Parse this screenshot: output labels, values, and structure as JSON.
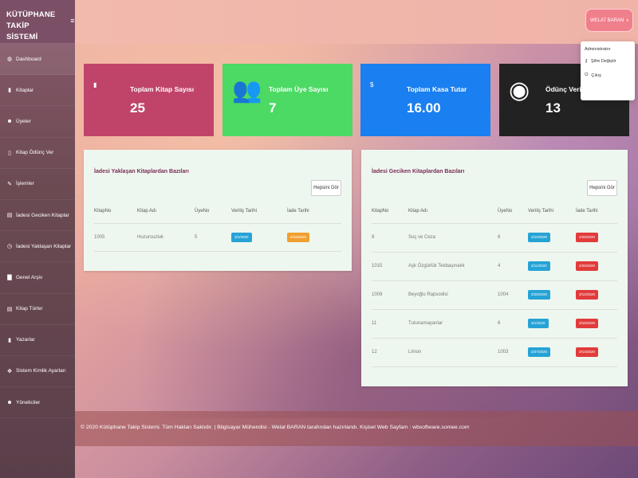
{
  "brand": {
    "title_line1": "KÜTÜPHANE TAKİP",
    "title_line2": "SİSTEMİ",
    "toggle_icon": "≡"
  },
  "sidebar": {
    "items": [
      {
        "label": "Dashboard",
        "icon": "dashboard-icon",
        "glyph": "◍"
      },
      {
        "label": "Kitaplar",
        "icon": "book-icon",
        "glyph": "▮"
      },
      {
        "label": "Üyeler",
        "icon": "users-icon",
        "glyph": "☻"
      },
      {
        "label": "Kitap Ödünç Ver",
        "icon": "lend-icon",
        "glyph": "▯"
      },
      {
        "label": "İşlemler",
        "icon": "pencil-icon",
        "glyph": "✎"
      },
      {
        "label": "İadesi Geciken Kitaplar",
        "icon": "late-book-icon",
        "glyph": "▤"
      },
      {
        "label": "İadesi Yaklaşan Kitaplar",
        "icon": "clock-icon",
        "glyph": "◷"
      },
      {
        "label": "Genel Arşiv",
        "icon": "archive-icon",
        "glyph": "▇"
      },
      {
        "label": "Kitap Türler",
        "icon": "category-icon",
        "glyph": "▤"
      },
      {
        "label": "Yazarlar",
        "icon": "author-icon",
        "glyph": "▮"
      },
      {
        "label": "Sistem Kimlik Ayarları",
        "icon": "settings-icon",
        "glyph": "✥"
      },
      {
        "label": "Yöneticiler",
        "icon": "admins-icon",
        "glyph": "☻"
      }
    ]
  },
  "header": {
    "user_label": "WELAT BARAN",
    "dropdown": {
      "role": "Administrator",
      "change_password": "Şifre Değiştir",
      "logout": "Çıkış"
    }
  },
  "stats": [
    {
      "title": "Toplam Kitap Sayısı",
      "value": "25",
      "icon": "book-icon",
      "glyph": "▮",
      "color": "#c0446a"
    },
    {
      "title": "Toplam Üye Sayısı",
      "value": "7",
      "icon": "users-icon",
      "glyph": "👥",
      "color": "#4cd964"
    },
    {
      "title": "Toplam Kasa Tutar",
      "value": "16.00",
      "icon": "money-icon",
      "glyph": "$",
      "color": "#1a7ff0"
    },
    {
      "title": "Ödünç Verilen",
      "value": "13",
      "icon": "lend-circle-icon",
      "glyph": "◉",
      "color": "#222222"
    }
  ],
  "upcoming": {
    "title": "İadesi Yaklaşan Kitaplardan Bazıları",
    "see_all": "Hepsini Gör",
    "columns": [
      "KitapNo",
      "Kitap Adı",
      "ÜyeNo",
      "Veriliş Tarihi",
      "İade Tarihi"
    ],
    "rows": [
      {
        "no": "1005",
        "name": "Huzursuzluk",
        "member": "5",
        "given": "3/1/2020",
        "return": "3/16/2020"
      }
    ]
  },
  "late": {
    "title": "İadesi Geciken Kitaplardan Bazıları",
    "see_all": "Hepsini Gör",
    "columns": [
      "KitapNo",
      "Kitap Adı",
      "ÜyeNo",
      "Veriliş Tarihi",
      "İade Tarihi"
    ],
    "rows": [
      {
        "no": "8",
        "name": "Suç ve Ceza",
        "member": "6",
        "given": "2/10/2020",
        "return": "2/25/2020"
      },
      {
        "no": "1015",
        "name": "Aşk Özgürlük Tekbaşınalık",
        "member": "4",
        "given": "2/11/2020",
        "return": "2/26/2020"
      },
      {
        "no": "1009",
        "name": "Beyoğlu Rapsodisi",
        "member": "1004",
        "given": "2/26/2020",
        "return": "3/12/2020"
      },
      {
        "no": "11",
        "name": "Tutunamayanlar",
        "member": "6",
        "given": "3/1/2020",
        "return": "3/16/2020"
      },
      {
        "no": "12",
        "name": "Limon",
        "member": "1003",
        "given": "2/27/2020",
        "return": "3/14/2020"
      }
    ]
  },
  "footer": {
    "text": "© 2020 Kütüphane Takip Sistemi. Tüm Hakları Saklıdır. | Bilgisayar Mühendisi - Welat BARAN tarafından hazırlandı. Kişisel Web Sayfam : wbsoftware.somee.com"
  }
}
